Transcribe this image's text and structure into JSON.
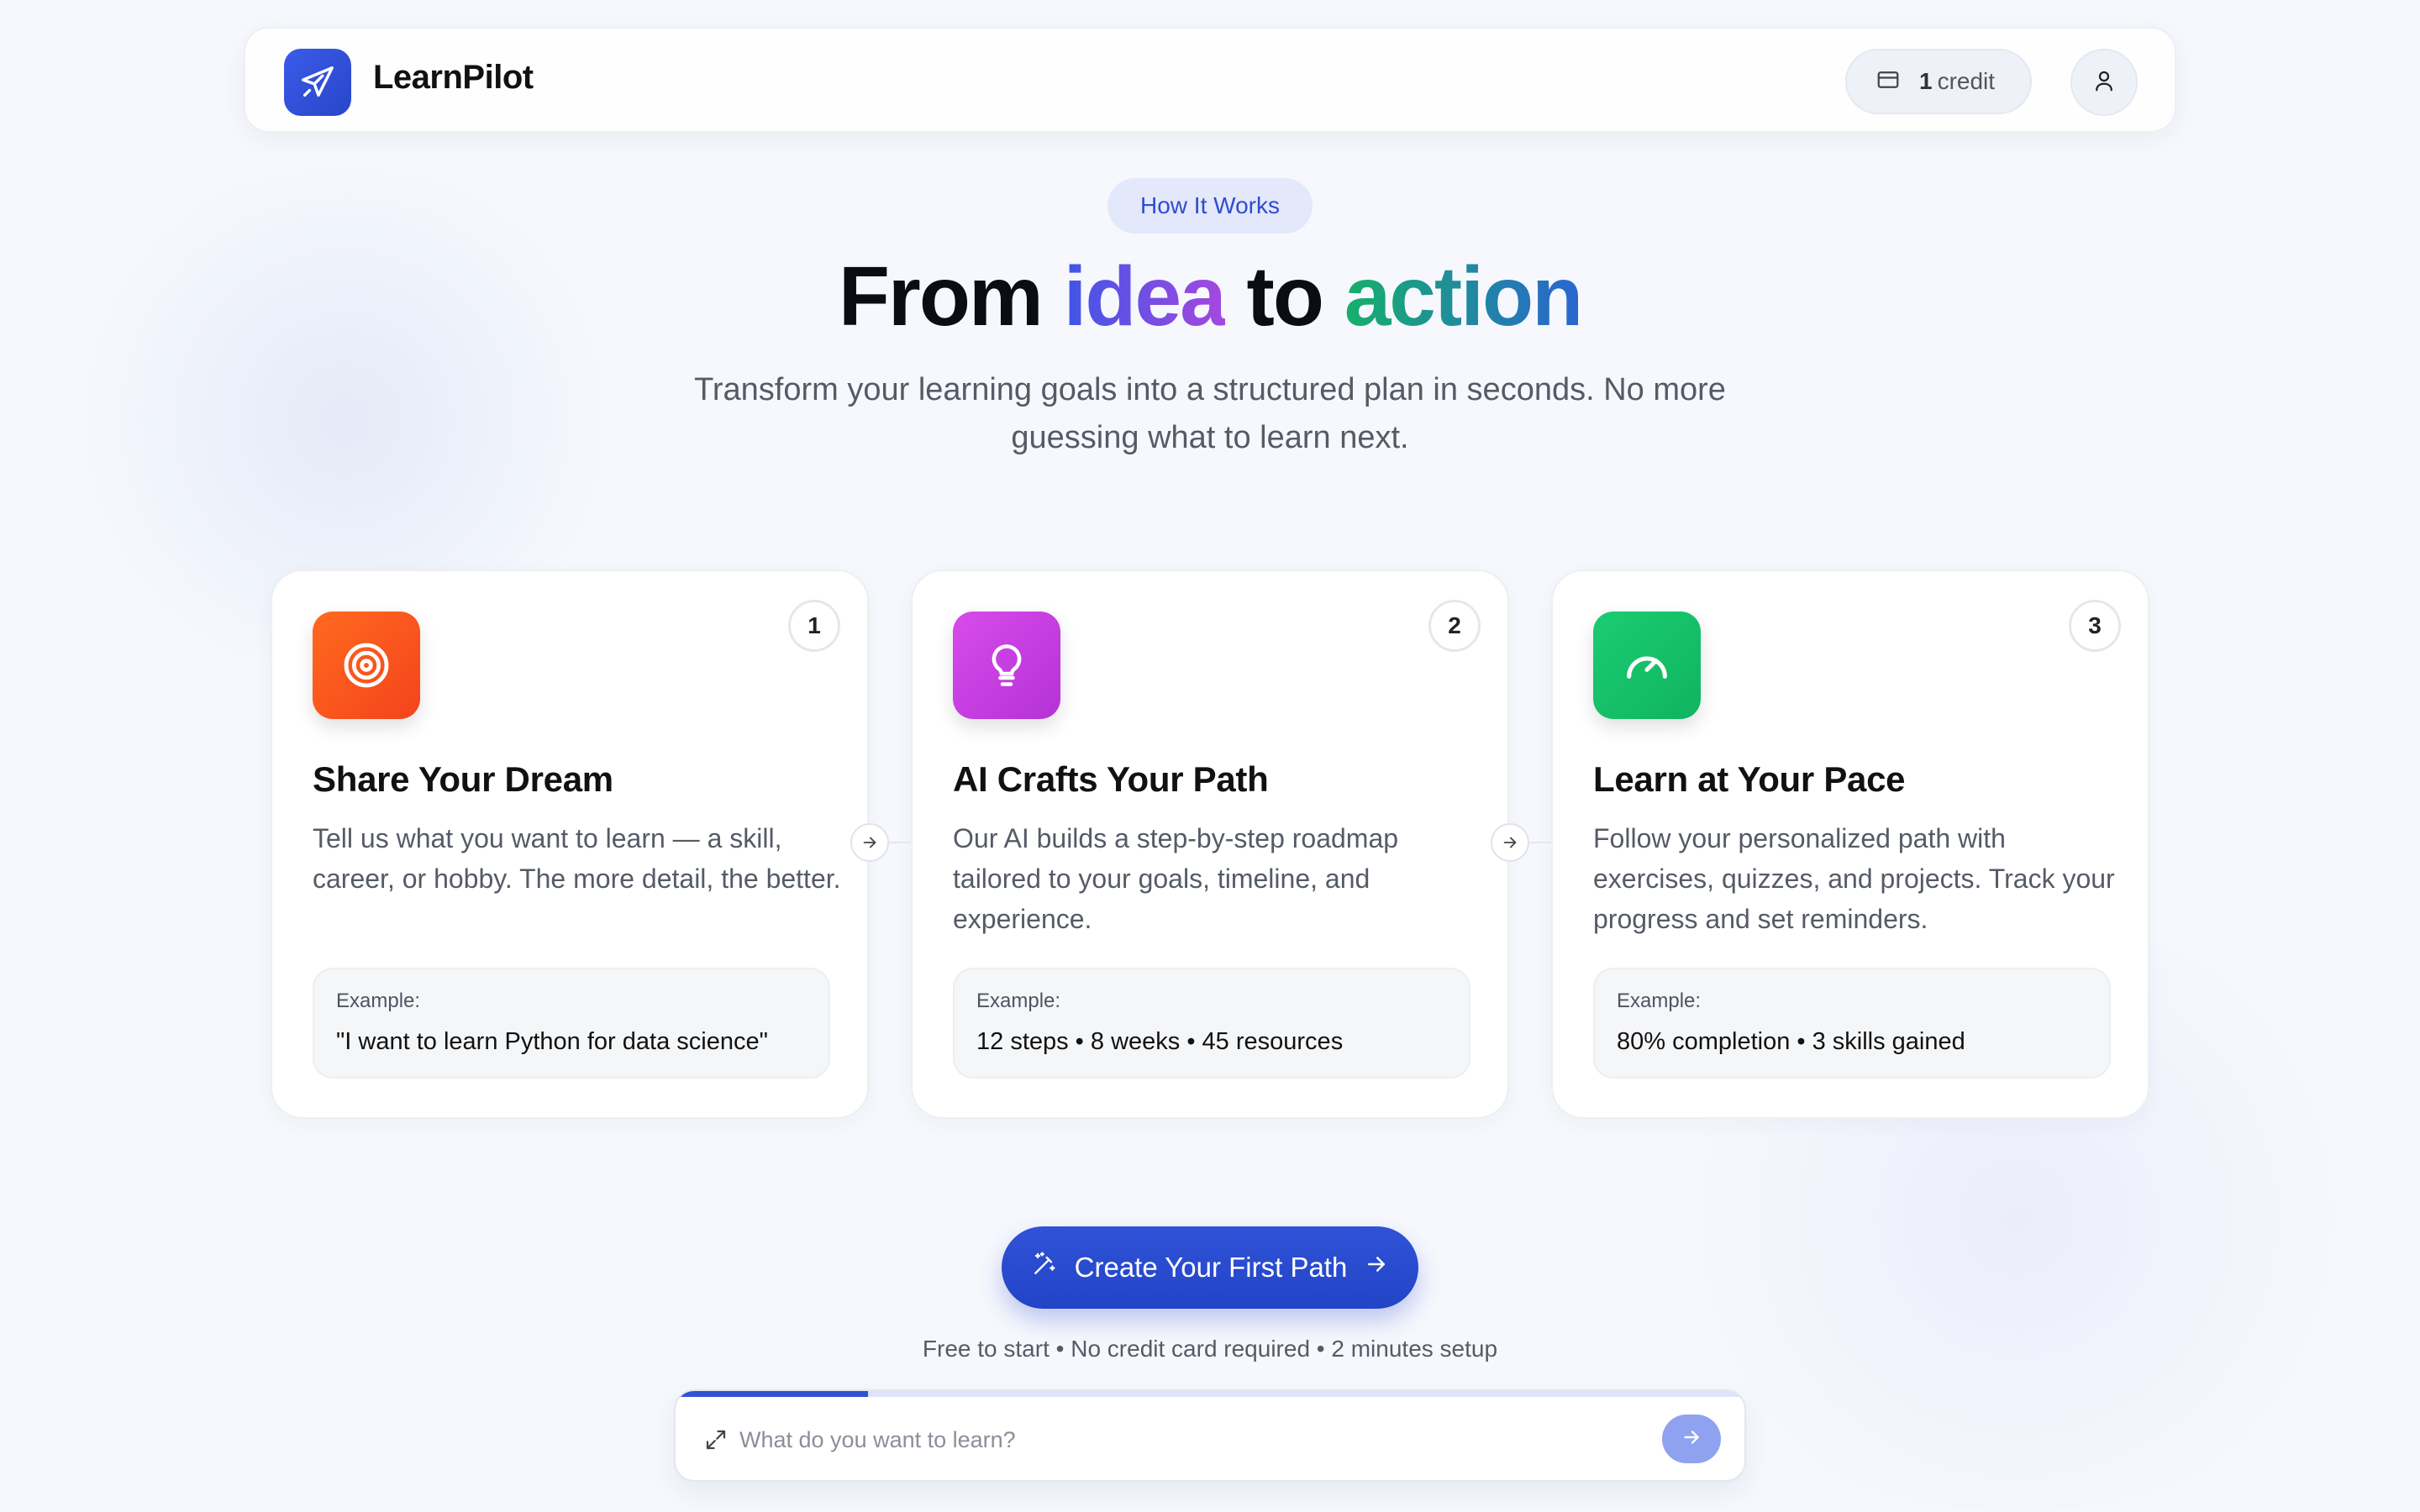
{
  "app": {
    "name": "LearnPilot"
  },
  "header": {
    "credits_count": "1",
    "credits_label": "credit"
  },
  "hero": {
    "badge": "How It Works",
    "title_part1": "From ",
    "title_word1": "idea",
    "title_part2": " to ",
    "title_word2": "action",
    "subtitle": "Transform your learning goals into a structured plan in seconds. No more guessing what to learn next."
  },
  "steps": [
    {
      "number": "1",
      "icon": "target-icon",
      "icon_color": "#ff5a1f",
      "title": "Share Your Dream",
      "description": "Tell us what you want to learn — a skill, career, or hobby. The more detail, the better.",
      "example_label": "Example:",
      "example_value": "\"I want to learn Python for data science\""
    },
    {
      "number": "2",
      "icon": "lightbulb-icon",
      "icon_color": "#c03ee0",
      "title": "AI Crafts Your Path",
      "description": "Our AI builds a step-by-step roadmap tailored to your goals, timeline, and experience.",
      "example_label": "Example:",
      "example_value": "12 steps • 8 weeks • 45 resources"
    },
    {
      "number": "3",
      "icon": "gauge-icon",
      "icon_color": "#12c26a",
      "title": "Learn at Your Pace",
      "description": "Follow your personalized path with exercises, quizzes, and projects. Track your progress and set reminders.",
      "example_label": "Example:",
      "example_value": "80% completion • 3 skills gained"
    }
  ],
  "cta": {
    "label": "Create Your First Path",
    "fine_print": "Free to start • No credit card required • 2 minutes setup"
  },
  "search": {
    "placeholder": "What do you want to learn?",
    "progress": 0.18
  },
  "colors": {
    "accent": "#2f52d8",
    "badge_bg": "#e3e8fb"
  }
}
